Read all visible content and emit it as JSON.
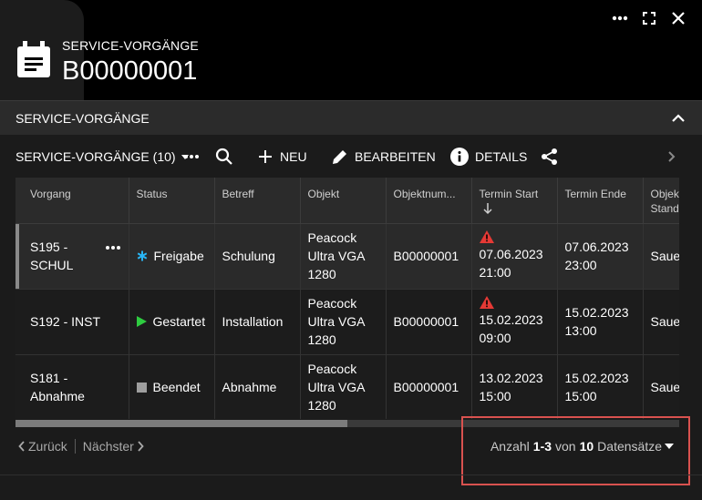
{
  "header": {
    "subtitle": "SERVICE-VORGÄNGE",
    "title": "B00000001"
  },
  "section": {
    "title": "SERVICE-VORGÄNGE"
  },
  "toolbar": {
    "view_label": "SERVICE-VORGÄNGE (10)",
    "new_label": "NEU",
    "edit_label": "BEARBEITEN",
    "details_label": "DETAILS"
  },
  "grid": {
    "columns": [
      "Vorgang",
      "Status",
      "Betreff",
      "Objekt",
      "Objektnum...",
      "Termin Start",
      "Termin Ende",
      "Objekt Standort"
    ],
    "rows": [
      {
        "vorgang": "S195 - SCHUL",
        "status": "Freigabe",
        "betreff": "Schulung",
        "objekt": "Peacock Ultra VGA 1280",
        "objektnummer": "B00000001",
        "termin_start": "07.06.2023 21:00",
        "termin_ende": "07.06.2023 23:00",
        "standort": "Sauer"
      },
      {
        "vorgang": "S192 - INST",
        "status": "Gestartet",
        "betreff": "Installation",
        "objekt": "Peacock Ultra VGA 1280",
        "objektnummer": "B00000001",
        "termin_start": "15.02.2023 09:00",
        "termin_ende": "15.02.2023 13:00",
        "standort": "Sauer"
      },
      {
        "vorgang": "S181 - Abnahme",
        "status": "Beendet",
        "betreff": "Abnahme",
        "objekt": "Peacock Ultra VGA 1280",
        "objektnummer": "B00000001",
        "termin_start": "13.02.2023 15:00",
        "termin_ende": "15.02.2023 15:00",
        "standort": "Sauer"
      }
    ]
  },
  "scroll": {
    "horizontal_position": 0,
    "visible_fraction": 0.5
  },
  "pager": {
    "prev_label": "Zurück",
    "next_label": "Nächster",
    "count_prefix": "Anzahl",
    "count_range": "1-3",
    "count_of": "von",
    "count_total": "10",
    "count_suffix": "Datensätze"
  },
  "colors": {
    "status_freigabe": "#29b6f6",
    "status_gestartet": "#2ecc40",
    "status_beendet": "#9e9e9e",
    "warning": "#e53935",
    "highlight": "#d9524f"
  },
  "icons": [
    "calendar-record-icon",
    "more-icon",
    "fullscreen-icon",
    "close-icon",
    "chevron-up-icon",
    "caret-down-icon",
    "search-icon",
    "plus-icon",
    "pencil-icon",
    "info-icon",
    "share-icon",
    "chevron-right-icon",
    "warning-icon",
    "sort-down-icon",
    "chevron-left-icon"
  ]
}
